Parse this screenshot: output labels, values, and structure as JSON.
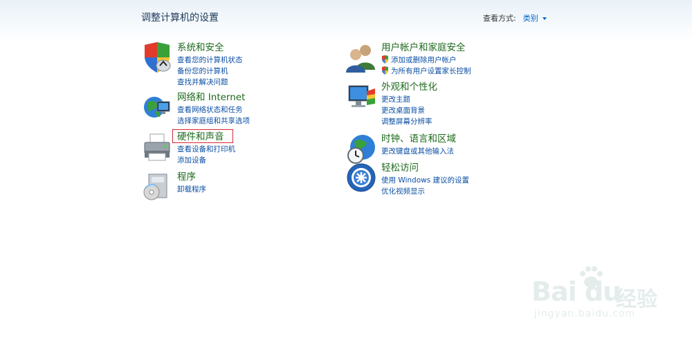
{
  "header": {
    "title": "调整计算机的设置",
    "view_by_label": "查看方式:",
    "view_by_value": "类别"
  },
  "categories": [
    {
      "title": "系统和安全",
      "links": [
        "查看您的计算机状态",
        "备份您的计算机",
        "查找并解决问题"
      ]
    },
    {
      "title": "网络和 Internet",
      "links": [
        "查看网络状态和任务",
        "选择家庭组和共享选项"
      ]
    },
    {
      "title": "硬件和声音",
      "links": [
        "查看设备和打印机",
        "添加设备"
      ]
    },
    {
      "title": "程序",
      "links": [
        "卸载程序"
      ]
    },
    {
      "title": "用户帐户和家庭安全",
      "links": [
        "添加或删除用户帐户",
        "为所有用户设置家长控制"
      ]
    },
    {
      "title": "外观和个性化",
      "links": [
        "更改主题",
        "更改桌面背景",
        "调整屏幕分辨率"
      ]
    },
    {
      "title": "时钟、语言和区域",
      "links": [
        "更改键盘或其他输入法"
      ]
    },
    {
      "title": "轻松访问",
      "links": [
        "使用 Windows 建议的设置",
        "优化视频显示"
      ]
    }
  ],
  "watermark": {
    "logo": "Bai du",
    "text": "经验",
    "url": "jingyan.baidu.com"
  },
  "colors": {
    "title_green": "#1c6a1c",
    "link_blue": "#0b4fa4",
    "highlight_red": "#d9262e"
  }
}
